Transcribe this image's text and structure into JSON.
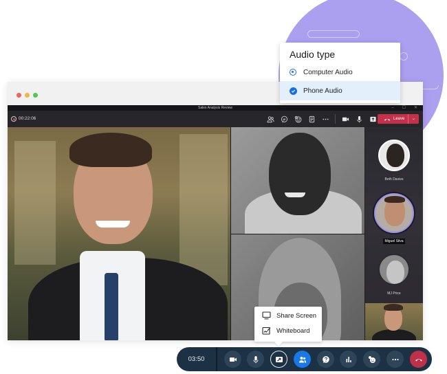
{
  "window": {
    "title": "Sales Analysis Review",
    "controls": [
      "–",
      "☐",
      "✕"
    ],
    "traffic_lights": [
      "close",
      "minimize",
      "maximize"
    ]
  },
  "toolbar": {
    "recording_timer": "00:22:06",
    "icons": [
      "participants-icon",
      "chat-icon",
      "reactions-icon",
      "notes-icon",
      "more-icon",
      "camera-icon",
      "mic-icon",
      "share-icon"
    ],
    "leave_label": "Leave"
  },
  "audio_popup": {
    "title": "Audio type",
    "options": [
      {
        "label": "Computer Audio",
        "state": "radio-selected"
      },
      {
        "label": "Phone Audio",
        "state": "checked",
        "highlighted": true
      }
    ]
  },
  "participants": [
    {
      "name": "Beth Davies",
      "active": false
    },
    {
      "name": "Miguel Silva",
      "active": true
    },
    {
      "name": "MJ Price",
      "active": false
    }
  ],
  "share_menu": {
    "items": [
      {
        "label": "Share Screen",
        "icon": "monitor-icon"
      },
      {
        "label": "Whiteboard",
        "icon": "whiteboard-icon"
      }
    ]
  },
  "control_bar": {
    "timer": "03:50",
    "buttons": [
      "camera",
      "microphone",
      "share",
      "participants",
      "help",
      "polls",
      "reactions",
      "more",
      "end-call"
    ]
  },
  "colors": {
    "accent_purple": "#ab9ff0",
    "leave_red": "#c4314b",
    "primary_blue": "#1778e6",
    "control_bar_navy": "#1c3244",
    "end_call_red": "#c03049"
  }
}
